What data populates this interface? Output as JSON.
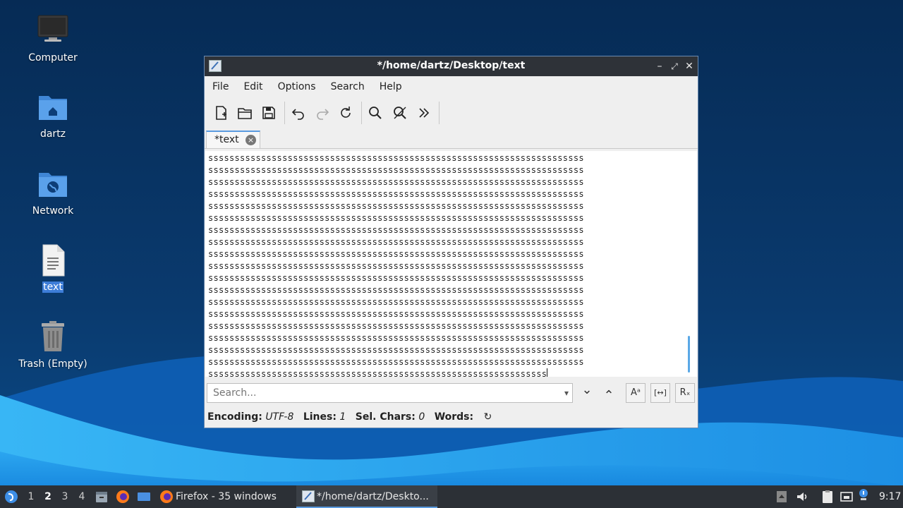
{
  "desktop": {
    "icons": [
      {
        "label": "Computer",
        "icon": "computer-icon"
      },
      {
        "label": "dartz",
        "icon": "home-folder-icon"
      },
      {
        "label": "Network",
        "icon": "network-folder-icon"
      },
      {
        "label": "text",
        "icon": "text-file-icon"
      },
      {
        "label": "Trash (Empty)",
        "icon": "trash-icon"
      }
    ]
  },
  "window": {
    "title": "*/home/dartz/Desktop/text",
    "controls": {
      "minimize": "–",
      "maximize": "⤢",
      "close": "✕"
    },
    "menu": [
      "File",
      "Edit",
      "Options",
      "Search",
      "Help"
    ],
    "toolbar": [
      "new-document-icon",
      "open-folder-icon",
      "save-icon",
      "undo-icon",
      "redo-icon",
      "reload-icon",
      "find-icon",
      "find-replace-icon",
      "more-chevron-icon"
    ],
    "tab": {
      "label": "*text",
      "close": "×"
    },
    "editor": {
      "full_lines": [
        "sssssssssssssssssssssssssssssssssssssssssssssssssssssssssssssssssssssss",
        "sssssssssssssssssssssssssssssssssssssssssssssssssssssssssssssssssssssss",
        "sssssssssssssssssssssssssssssssssssssssssssssssssssssssssssssssssssssss",
        "sssssssssssssssssssssssssssssssssssssssssssssssssssssssssssssssssssssss",
        "sssssssssssssssssssssssssssssssssssssssssssssssssssssssssssssssssssssss",
        "sssssssssssssssssssssssssssssssssssssssssssssssssssssssssssssssssssssss",
        "sssssssssssssssssssssssssssssssssssssssssssssssssssssssssssssssssssssss",
        "sssssssssssssssssssssssssssssssssssssssssssssssssssssssssssssssssssssss",
        "sssssssssssssssssssssssssssssssssssssssssssssssssssssssssssssssssssssss",
        "sssssssssssssssssssssssssssssssssssssssssssssssssssssssssssssssssssssss",
        "sssssssssssssssssssssssssssssssssssssssssssssssssssssssssssssssssssssss",
        "sssssssssssssssssssssssssssssssssssssssssssssssssssssssssssssssssssssss",
        "sssssssssssssssssssssssssssssssssssssssssssssssssssssssssssssssssssssss",
        "sssssssssssssssssssssssssssssssssssssssssssssssssssssssssssssssssssssss",
        "sssssssssssssssssssssssssssssssssssssssssssssssssssssssssssssssssssssss",
        "sssssssssssssssssssssssssssssssssssssssssssssssssssssssssssssssssssssss",
        "sssssssssssssssssssssssssssssssssssssssssssssssssssssssssssssssssssssss",
        "sssssssssssssssssssssssssssssssssssssssssssssssssssssssssssssssssssssss"
      ],
      "last_line": "ssssssssssssssssssssssssssssssssssssssssssssssssssssssssssssssss"
    },
    "search": {
      "placeholder": "Search...",
      "down": "⌄",
      "up": "⌃",
      "match_case": "Aᵃ",
      "whole_word": "[↔]",
      "regex": "Rₓ"
    },
    "status": {
      "encoding_label": "Encoding:",
      "encoding": "UTF-8",
      "lines_label": "Lines:",
      "lines": "1",
      "selchars_label": "Sel. Chars:",
      "selchars": "0",
      "words_label": "Words:",
      "refresh": "↻"
    }
  },
  "taskbar": {
    "workspaces": [
      "1",
      "2",
      "3",
      "4"
    ],
    "active_workspace": "2",
    "tasks": [
      {
        "label": "Firefox - 35 windows",
        "icon": "firefox-icon"
      },
      {
        "label": "*/home/dartz/Deskto...",
        "icon": "text-editor-icon"
      }
    ],
    "clock": "9:17"
  }
}
